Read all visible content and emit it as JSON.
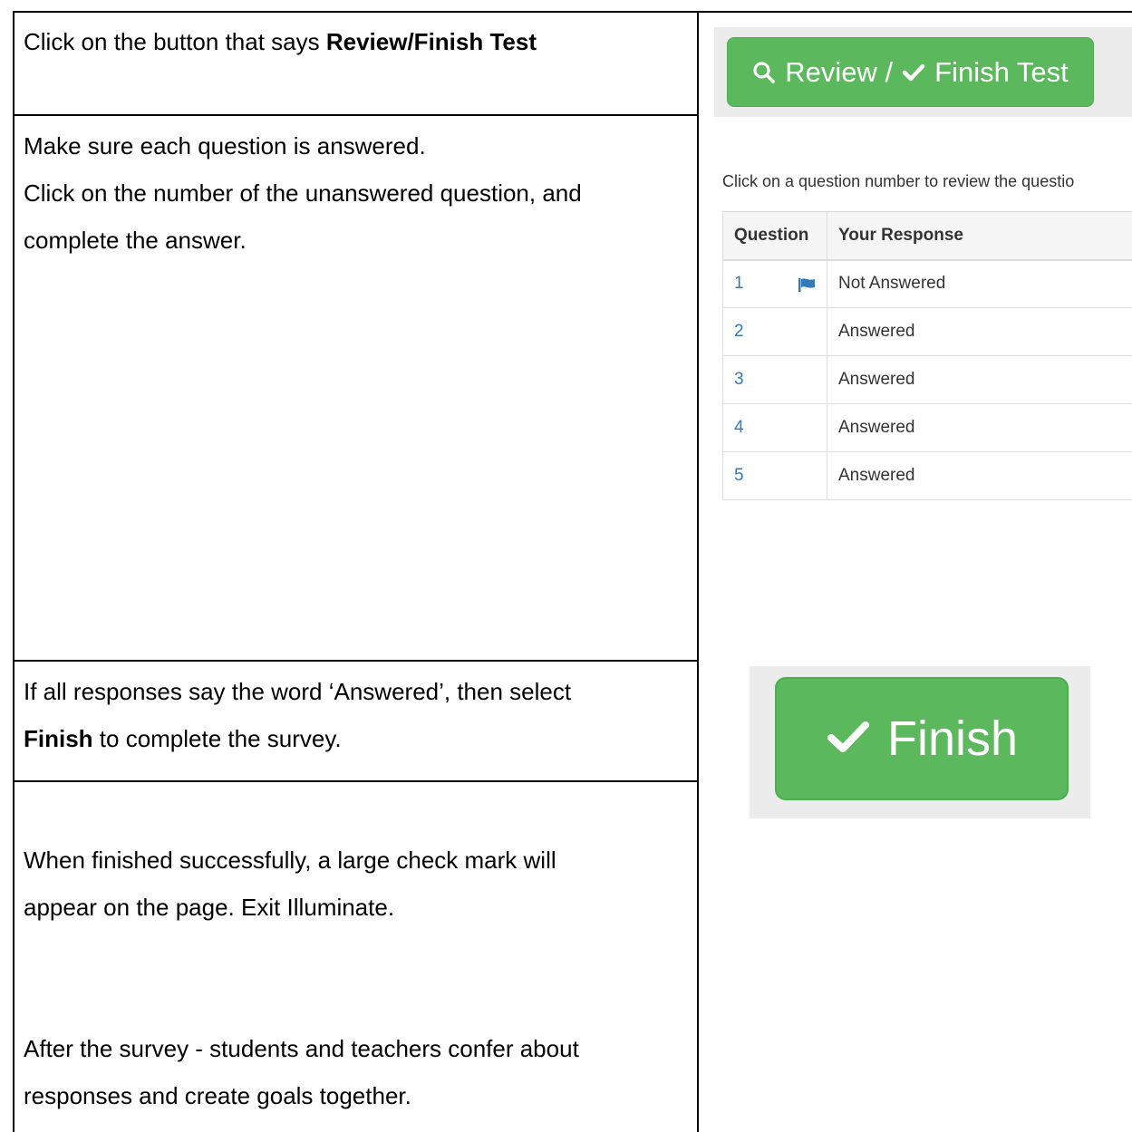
{
  "rows": {
    "step1": {
      "prefix": "Click on the button that says ",
      "bold": "Review/Finish Test"
    },
    "step2": {
      "line1": "Make sure each question is answered.",
      "line2": "Click on the number of the unanswered question, and",
      "line3": "complete the answer."
    },
    "step3": {
      "line1": "If all responses say the word ‘Answered’, then select",
      "bold": "Finish",
      "suffix": " to complete the survey."
    },
    "step4": {
      "line1": "When finished successfully, a large check mark will",
      "line2": "appear on the page.  Exit Illuminate.",
      "line3": "After the survey - students and teachers confer about",
      "line4": "responses and create goals together."
    }
  },
  "review_button": {
    "label_review": "Review /",
    "label_finish": "Finish Test",
    "icons": [
      "search-icon",
      "check-icon"
    ],
    "color": "#5cb85c"
  },
  "review_panel": {
    "instruction": "Click on a question number to review the questio",
    "headers": {
      "question": "Question",
      "response": "Your Response"
    },
    "rows": [
      {
        "num": "1",
        "response": "Not Answered",
        "flagged": true
      },
      {
        "num": "2",
        "response": "Answered",
        "flagged": false
      },
      {
        "num": "3",
        "response": "Answered",
        "flagged": false
      },
      {
        "num": "4",
        "response": "Answered",
        "flagged": false
      },
      {
        "num": "5",
        "response": "Answered",
        "flagged": false
      }
    ],
    "link_color": "#337ab7"
  },
  "finish_button": {
    "label": "Finish",
    "icon": "check-icon",
    "color": "#5cb85c"
  }
}
